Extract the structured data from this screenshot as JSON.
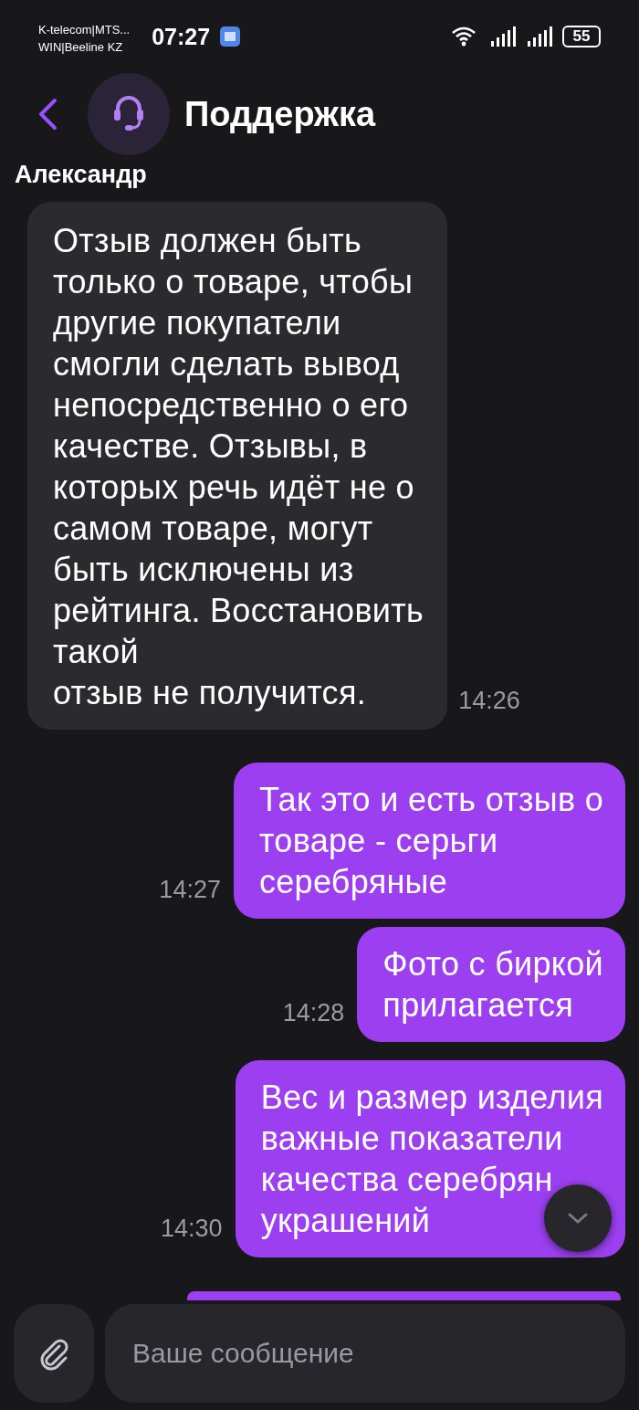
{
  "status_bar": {
    "carriers": [
      "K-telecom|MTS...",
      "WIN|Beeline KZ"
    ],
    "time": "07:27",
    "battery": "55"
  },
  "header": {
    "title": "Поддержка"
  },
  "sender": "Александр",
  "messages": [
    {
      "kind": "incoming",
      "text": "Отзыв должен быть\nтолько о товаре, чтобы\nдругие покупатели\nсмогли сделать вывод\nнепосредственно о его\nкачестве. Отзывы, в\nкоторых речь идёт не о\nсамом товаре, могут\nбыть исключены из\nрейтинга. Восстановить\nтакой\nотзыв не получится.",
      "time": "14:26"
    },
    {
      "kind": "outgoing",
      "text": "Так это и есть отзыв о\nтоваре - серьги\nсеребряные",
      "time": "14:27"
    },
    {
      "kind": "outgoing",
      "text": "Фото с биркой\nприлагается",
      "time": "14:28"
    },
    {
      "kind": "outgoing",
      "text": "Вес и размер изделия\nважные показатели\nкачества серебрян\nукрашений",
      "time": "14:30"
    }
  ],
  "composer": {
    "placeholder": "Ваше сообщение"
  }
}
